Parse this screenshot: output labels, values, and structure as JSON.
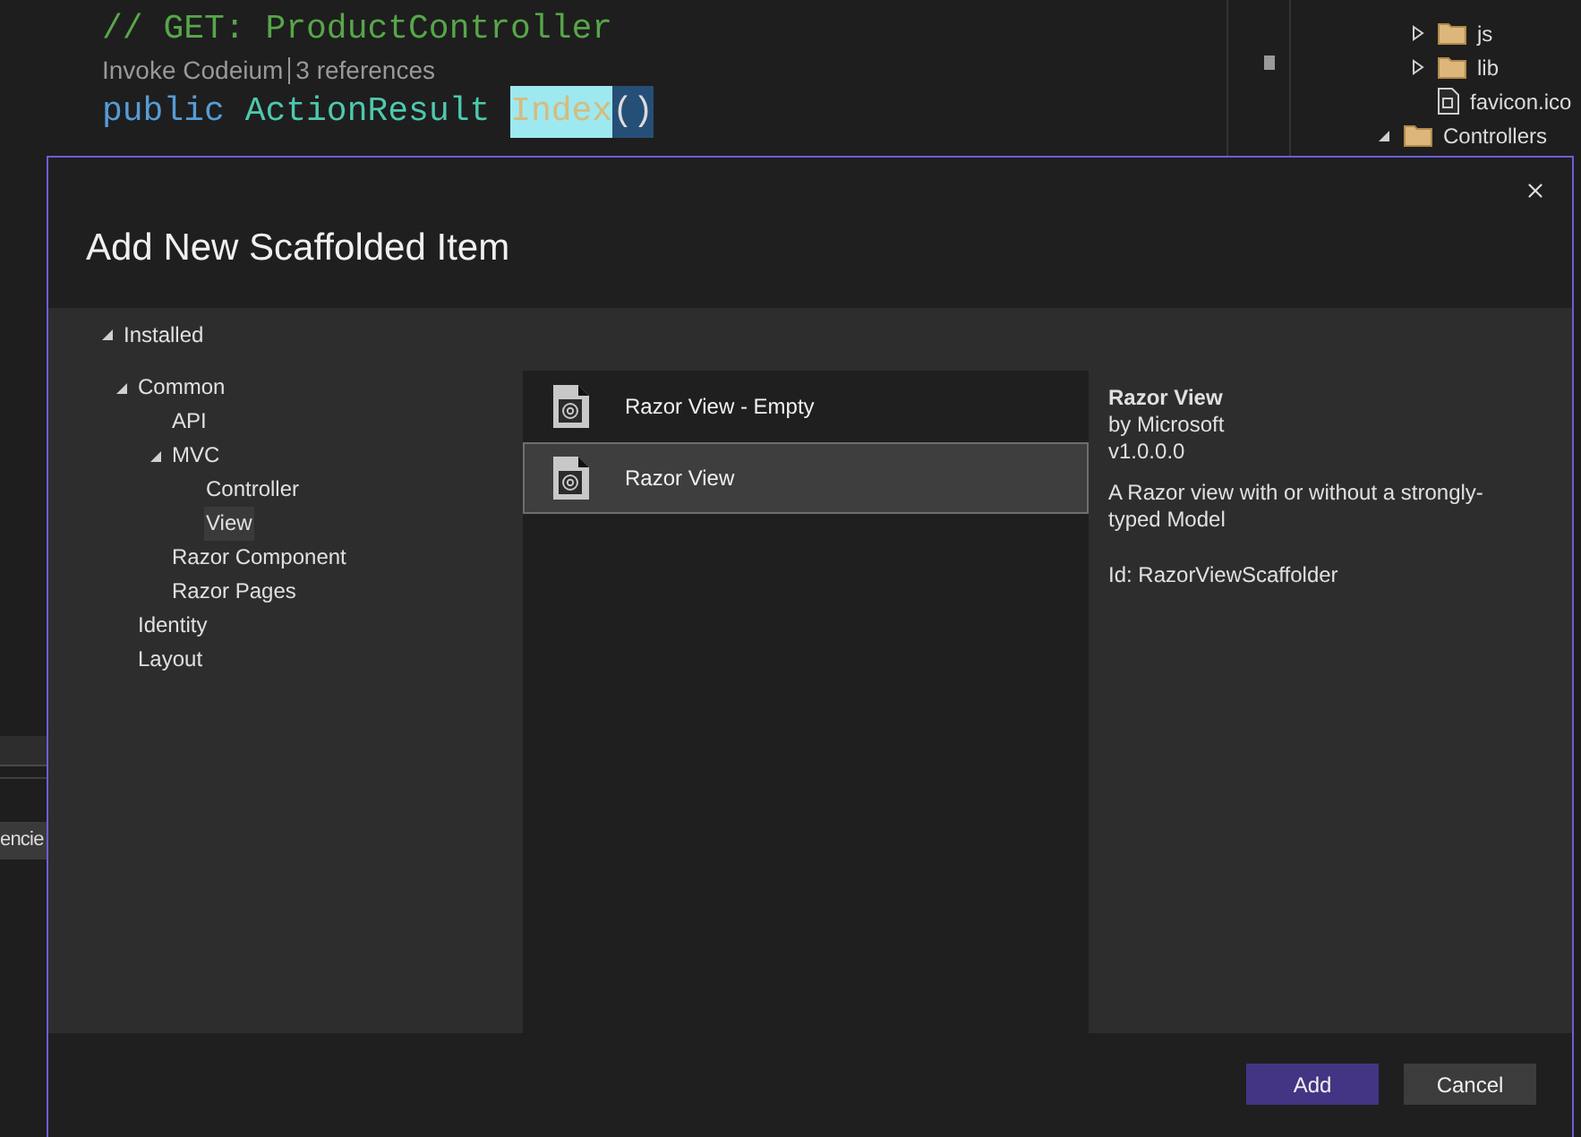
{
  "editor": {
    "code_lines": [
      {
        "kind": "comment",
        "tokens": [
          {
            "kind": "comment",
            "text": "// GET: ProductController"
          }
        ]
      },
      {
        "kind": "lens",
        "parts": [
          "Invoke Codeium",
          "3 references"
        ]
      },
      {
        "kind": "code",
        "tokens": [
          {
            "kind": "keyword",
            "text": "public"
          },
          {
            "kind": "type",
            "text": "ActionResult"
          },
          {
            "kind": "highlight",
            "text": "Index"
          },
          {
            "kind": "selection",
            "text": "()"
          }
        ]
      }
    ]
  },
  "solution_explorer": {
    "sub_items": [
      {
        "label": "js",
        "kind": "folder",
        "expanded": false
      },
      {
        "label": "lib",
        "kind": "folder",
        "expanded": false
      },
      {
        "label": "favicon.ico",
        "kind": "file"
      }
    ],
    "items": [
      {
        "label": "Controllers",
        "kind": "folder",
        "expanded": true
      }
    ]
  },
  "bottom_tab": {
    "label": "encie"
  },
  "dialog": {
    "title": "Add New Scaffolded Item",
    "tree": [
      {
        "label": "Installed",
        "expanded": true,
        "selected": false,
        "children": [
          {
            "label": "Common",
            "expanded": true,
            "selected": false,
            "children": [
              {
                "label": "API",
                "selected": false
              },
              {
                "label": "MVC",
                "expanded": true,
                "selected": false,
                "children": [
                  {
                    "label": "Controller",
                    "selected": false
                  },
                  {
                    "label": "View",
                    "selected": true
                  }
                ]
              },
              {
                "label": "Razor Component",
                "selected": false
              },
              {
                "label": "Razor Pages",
                "selected": false
              }
            ]
          },
          {
            "label": "Identity",
            "selected": false
          },
          {
            "label": "Layout",
            "selected": false
          }
        ]
      }
    ],
    "templates": [
      {
        "name": "Razor View - Empty",
        "selected": false
      },
      {
        "name": "Razor View",
        "selected": true
      }
    ],
    "details": {
      "name": "Razor View",
      "author": "by Microsoft",
      "version": "v1.0.0.0",
      "description": "A Razor view with or without a strongly-typed Model",
      "id": "Id: RazorViewScaffolder"
    },
    "buttons": [
      {
        "label": "Add",
        "kind": "primary"
      },
      {
        "label": "Cancel",
        "kind": "secondary"
      }
    ]
  }
}
